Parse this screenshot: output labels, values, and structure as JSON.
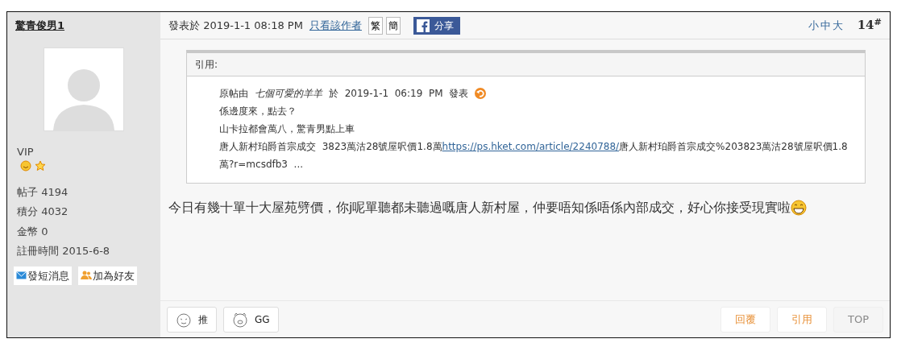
{
  "author": {
    "name": "驚青俊男1",
    "rank": "VIP",
    "stats": [
      {
        "label": "帖子",
        "value": "4194"
      },
      {
        "label": "積分",
        "value": "4032"
      },
      {
        "label": "金幣",
        "value": "0"
      },
      {
        "label": "註冊時間",
        "value": "2015-6-8"
      }
    ],
    "buttons": [
      {
        "label": "發短消息",
        "kind": "message"
      },
      {
        "label": "加為好友",
        "kind": "friend"
      }
    ]
  },
  "header": {
    "posted": "發表於 2019-1-1 08:18 PM",
    "author_only": "只看該作者",
    "script_buttons": [
      "繁",
      "簡"
    ],
    "share": "分享",
    "font_sizes": [
      "小",
      "中",
      "大"
    ],
    "floor": "14",
    "floor_mark": "#"
  },
  "quote": {
    "title": "引用:",
    "by_prefix": "原帖由",
    "by_author": "七個可愛的羊羊",
    "by_suffix": "於  2019-1-1  06:19  PM  發表",
    "lines": [
      "係邊度來，點去？",
      "山卡拉都會萬八，驚青男點上車"
    ],
    "link_line": {
      "before": "唐人新村珀爵首宗成交  3823萬沽28號屋呎價1.8萬",
      "link": "https://ps.hket.com/article/2240788/",
      "after": "唐人新村珀爵首宗成交%203823萬沽28號屋呎價1.8萬?r=mcsdfb3  ..."
    }
  },
  "body": "今日有幾十單十大屋苑劈價，你j呢單聽都未聽過嘅唐人新村屋，仲要唔知係唔係內部成交，好心你接受現實啦",
  "reactions": [
    {
      "label": "推",
      "kind": "smile"
    },
    {
      "label": "GG",
      "kind": "pig"
    }
  ],
  "actions": [
    {
      "label": "回覆",
      "kind": "reply"
    },
    {
      "label": "引用",
      "kind": "quote"
    },
    {
      "label": "TOP",
      "kind": "top"
    }
  ]
}
